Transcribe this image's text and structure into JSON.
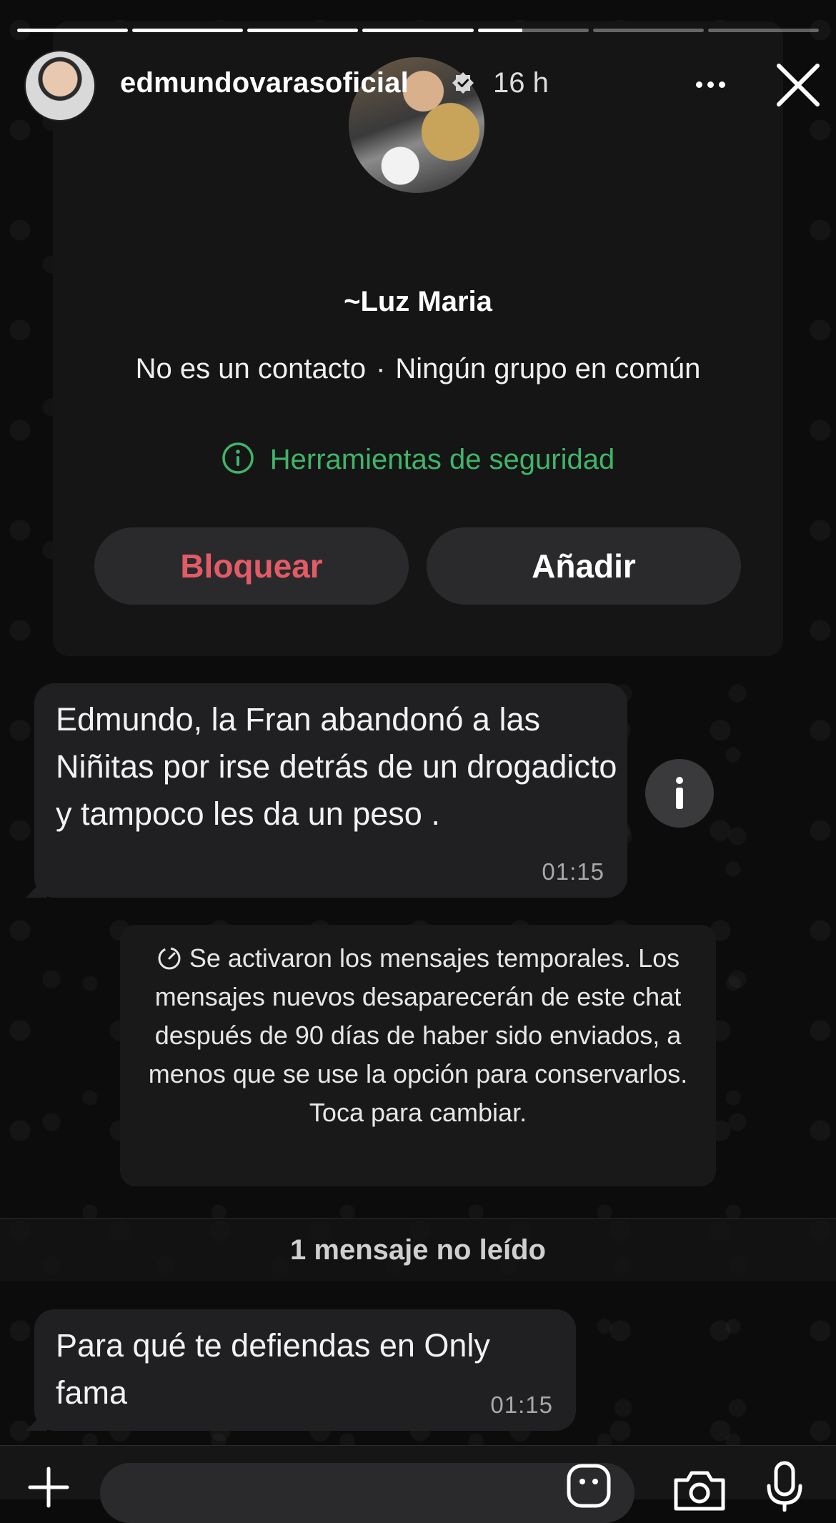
{
  "story": {
    "username": "edmundovarasoficial",
    "time_ago": "16 h",
    "segments": [
      1,
      1,
      1,
      1,
      0.4,
      0,
      0
    ]
  },
  "contact": {
    "name": "~Luz Maria",
    "not_contact": "No es un contacto",
    "separator": "·",
    "no_groups": "Ningún grupo en común",
    "security_tools": "Herramientas de seguridad",
    "block_label": "Bloquear",
    "add_label": "Añadir"
  },
  "messages": [
    {
      "text": "Edmundo, la Fran abandonó a las Niñitas por irse detrás de un drogadicto y tampoco les da un peso .",
      "time": "01:15"
    },
    {
      "text": "Para qué te defiendas en Only fama",
      "time": "01:15"
    }
  ],
  "system_notice": "Se activaron los mensajes temporales. Los mensajes nuevos desaparecerán de este chat después de 90 días de haber sido enviados, a menos que se use la opción para conservarlos. Toca para cambiar.",
  "unread_label": "1 mensaje no leído",
  "colors": {
    "block": "#e25b67",
    "security": "#3fb569",
    "bubble": "#202022"
  },
  "icons": [
    "verified-icon",
    "more-icon",
    "close-icon",
    "info-circle-icon",
    "info-icon",
    "timer-icon",
    "plus-icon",
    "sticker-icon",
    "camera-icon",
    "mic-icon"
  ]
}
